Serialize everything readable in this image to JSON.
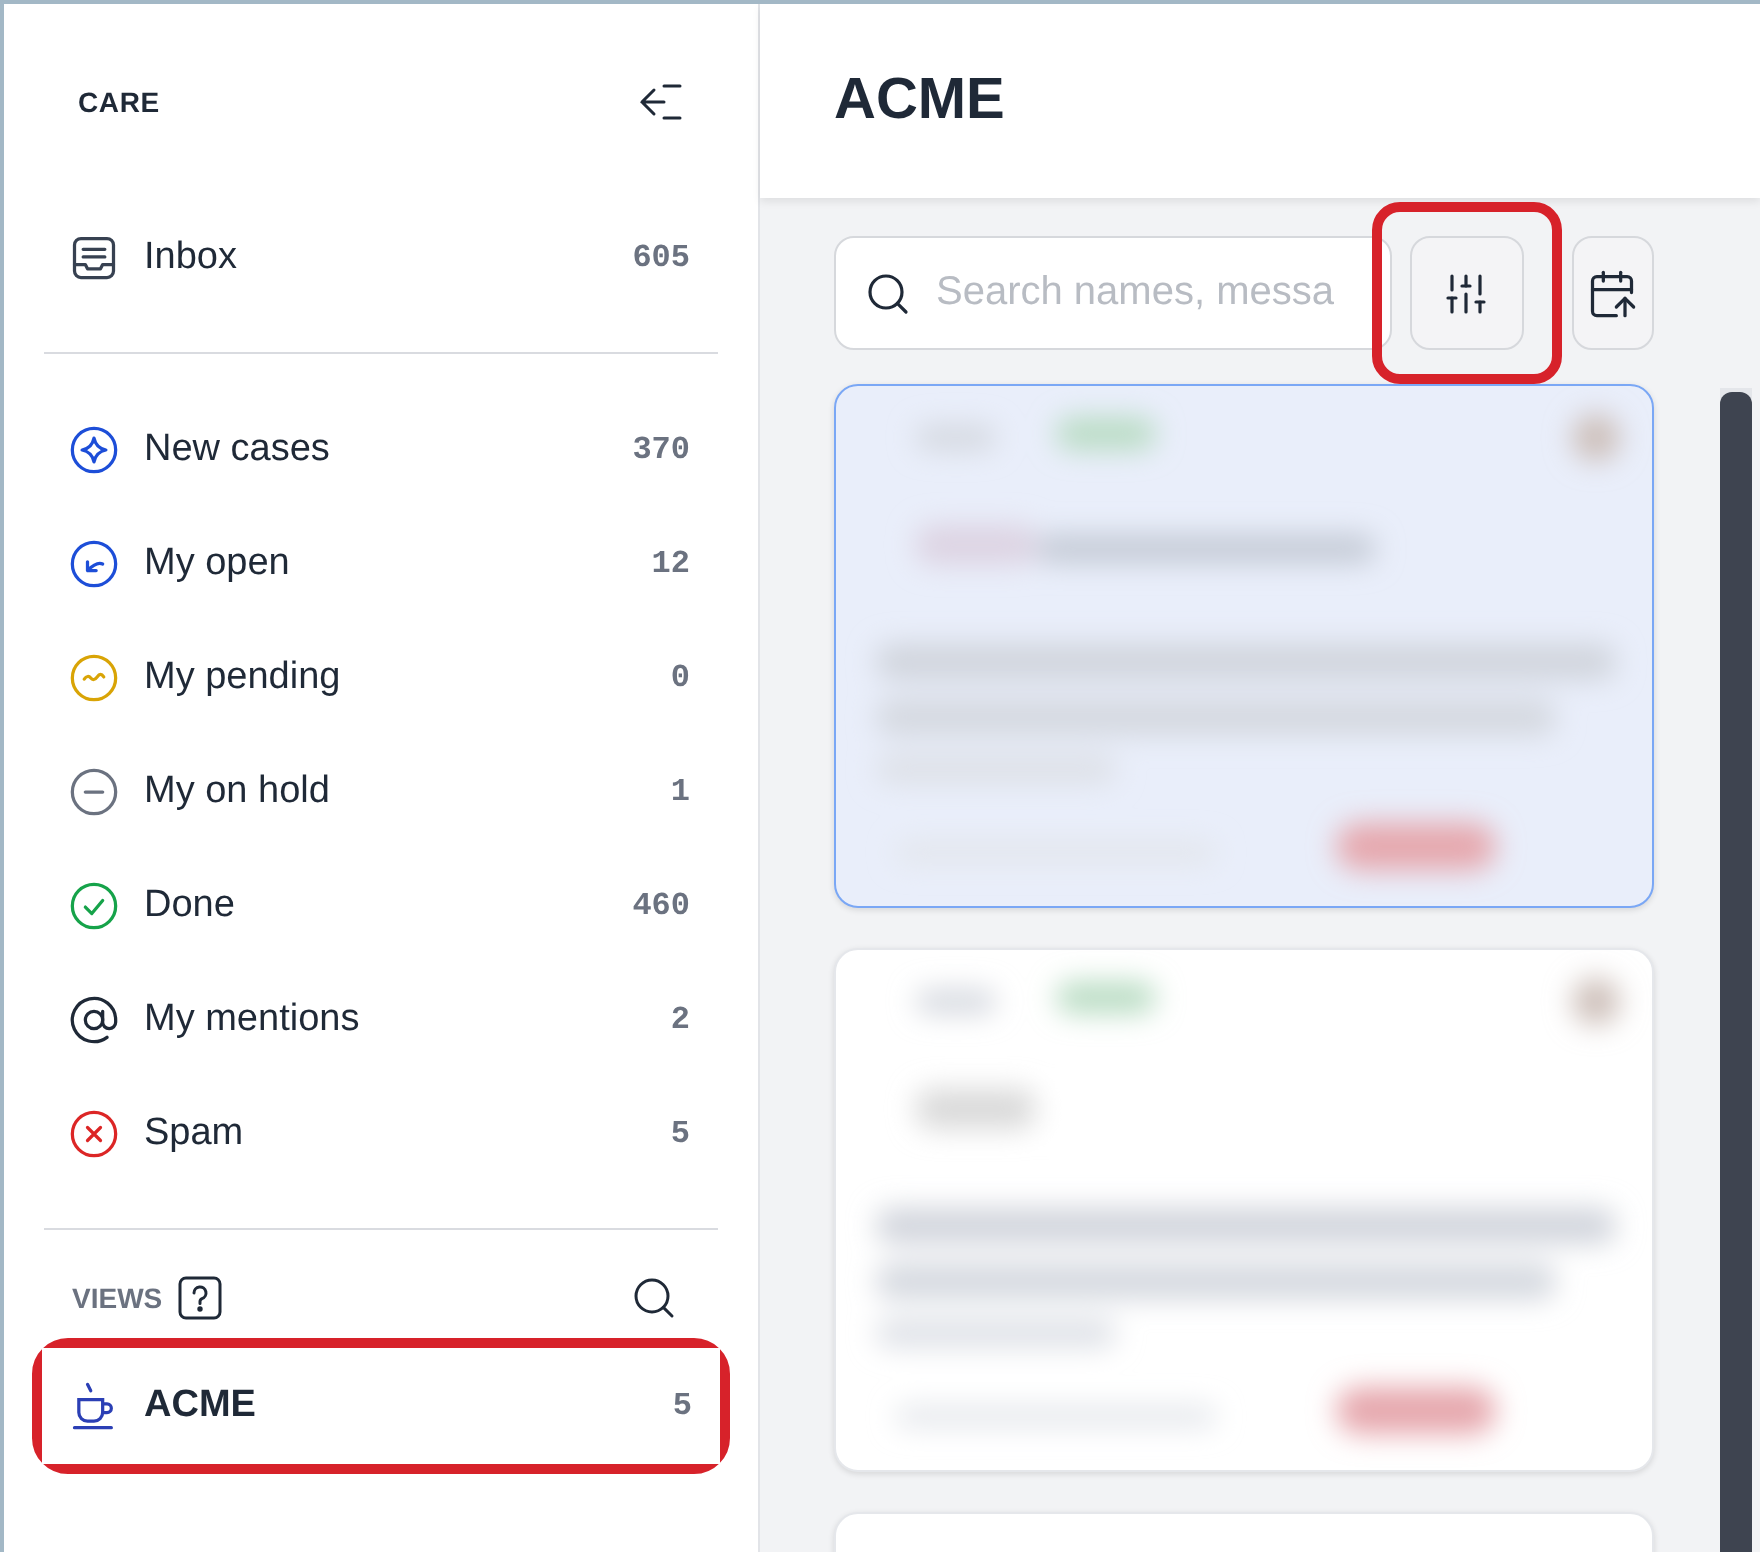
{
  "sidebar": {
    "title": "CARE",
    "inbox": {
      "label": "Inbox",
      "count": "605",
      "selected": false
    },
    "items": [
      {
        "kind": "sparkle",
        "label": "New cases",
        "count": "370",
        "color": "#1d4ed8",
        "selected": false
      },
      {
        "kind": "return",
        "label": "My open",
        "count": "12",
        "color": "#1d4ed8",
        "selected": false
      },
      {
        "kind": "tilde",
        "label": "My pending",
        "count": "0",
        "color": "#d9a406",
        "selected": false
      },
      {
        "kind": "minus",
        "label": "My on hold",
        "count": "1",
        "color": "#6b7280",
        "selected": false
      },
      {
        "kind": "check",
        "label": "Done",
        "count": "460",
        "color": "#16a34a",
        "selected": false
      },
      {
        "kind": "at",
        "label": "My mentions",
        "count": "2",
        "color": "#1f2937",
        "selected": false
      },
      {
        "kind": "cross",
        "label": "Spam",
        "count": "5",
        "color": "#dc2626",
        "selected": false
      }
    ],
    "views_heading": "VIEWS",
    "views": [
      {
        "label": "ACME",
        "count": "5",
        "selected": true,
        "highlighted": true
      }
    ]
  },
  "main": {
    "title": "ACME",
    "search": {
      "placeholder": "Search names, messa"
    },
    "filter_button": {
      "highlighted": true
    },
    "cards": [
      {
        "selected": true
      },
      {
        "selected": false
      },
      {
        "selected": false
      }
    ]
  }
}
